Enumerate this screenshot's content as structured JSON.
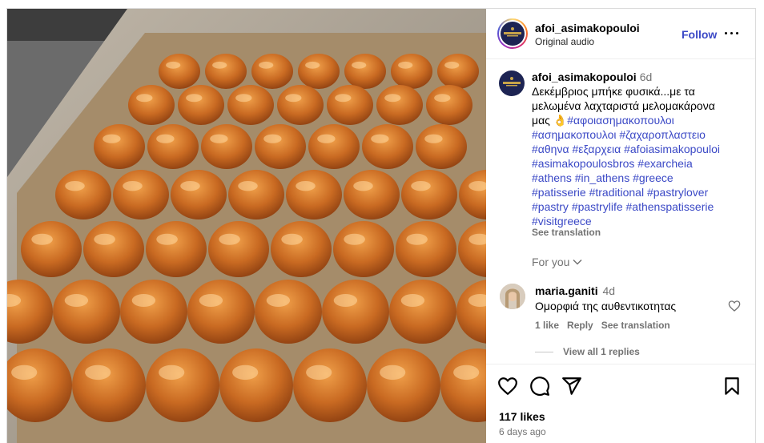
{
  "header": {
    "username": "afoi_asimakopouloi",
    "audio": "Original audio",
    "follow_label": "Follow"
  },
  "caption": {
    "username": "afoi_asimakopouloi",
    "time": "6d",
    "text_lines": [
      "Δεκέμβριος μπήκε φυσικά...με τα",
      "μελωμένα λαχταριστά μελομακάρονα"
    ],
    "text_last": "μας",
    "emoji": "👌",
    "tag_lines": [
      [
        "#αφοιασημακοπουλοι"
      ],
      [
        "#ασημακοπουλοι",
        "#ζαχαροπλαστειο"
      ],
      [
        "#αθηνα",
        "#εξαρχεια",
        "#afoiasimakopouloi"
      ],
      [
        "#asimakopoulosbros",
        "#exarcheia"
      ],
      [
        "#athens",
        "#in_athens",
        "#greece"
      ],
      [
        "#patisserie",
        "#traditional",
        "#pastrylover"
      ],
      [
        "#pastry",
        "#pastrylife",
        "#athenspatisserie"
      ],
      [
        "#visitgreece"
      ]
    ],
    "see_translation": "See translation"
  },
  "for_you": "For you",
  "comment": {
    "username": "maria.ganiti",
    "time": "4d",
    "text": "Ομορφιά της αυθεντικοτητας",
    "likes": "1 like",
    "reply": "Reply",
    "see_translation": "See translation",
    "view_replies": "View all 1 replies"
  },
  "footer": {
    "likes": "117 likes",
    "ago": "6 days ago"
  },
  "colors": {
    "link": "#3b49c6",
    "muted": "#737373",
    "pastry": "#c9702a"
  }
}
